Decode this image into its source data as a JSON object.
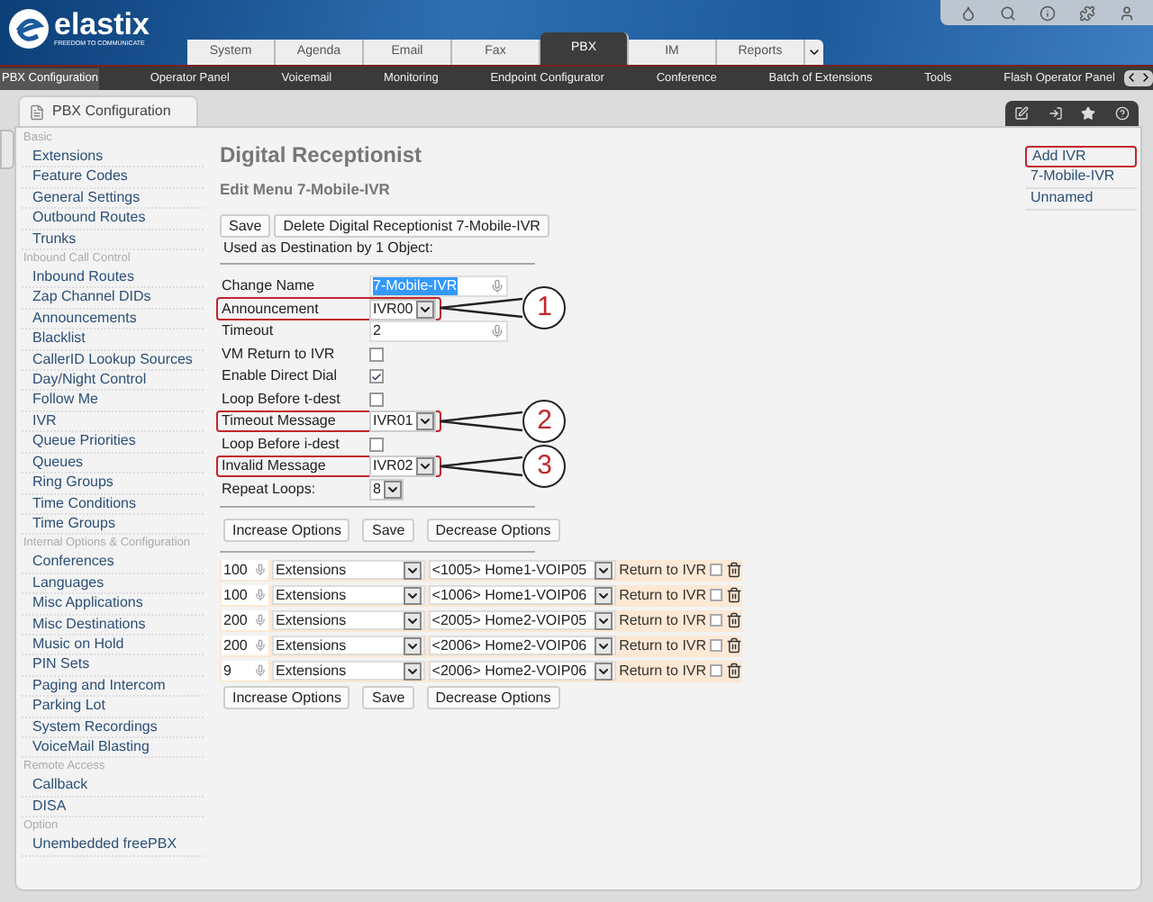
{
  "header": {
    "logo": "elastix",
    "tagline": "FREEDOM TO COMMUNICATE",
    "tabs": [
      {
        "label": "System",
        "selected": false
      },
      {
        "label": "Agenda",
        "selected": false
      },
      {
        "label": "Email",
        "selected": false
      },
      {
        "label": "Fax",
        "selected": false
      },
      {
        "label": "PBX",
        "selected": true
      },
      {
        "label": "IM",
        "selected": false
      },
      {
        "label": "Reports",
        "selected": false
      }
    ]
  },
  "menu": [
    {
      "label": "PBX Configuration",
      "selected": true
    },
    {
      "label": "Operator Panel",
      "selected": false
    },
    {
      "label": "Voicemail",
      "selected": false
    },
    {
      "label": "Monitoring",
      "selected": false
    },
    {
      "label": "Endpoint Configurator",
      "selected": false
    },
    {
      "label": "Conference",
      "selected": false
    },
    {
      "label": "Batch of Extensions",
      "selected": false
    },
    {
      "label": "Tools",
      "selected": false
    },
    {
      "label": "Flash Operator Panel",
      "selected": false
    }
  ],
  "page_tab": "PBX Configuration",
  "sidebar": [
    {
      "kind": "heading",
      "label": "Basic"
    },
    {
      "kind": "link",
      "label": "Extensions"
    },
    {
      "kind": "link",
      "label": "Feature Codes"
    },
    {
      "kind": "link",
      "label": "General Settings"
    },
    {
      "kind": "link",
      "label": "Outbound Routes"
    },
    {
      "kind": "link",
      "label": "Trunks"
    },
    {
      "kind": "heading",
      "label": "Inbound Call Control"
    },
    {
      "kind": "link",
      "label": "Inbound Routes"
    },
    {
      "kind": "link",
      "label": "Zap Channel DIDs"
    },
    {
      "kind": "link",
      "label": "Announcements"
    },
    {
      "kind": "link",
      "label": "Blacklist"
    },
    {
      "kind": "link",
      "label": "CallerID Lookup Sources"
    },
    {
      "kind": "link",
      "label": "Day/Night Control"
    },
    {
      "kind": "link",
      "label": "Follow Me"
    },
    {
      "kind": "link",
      "label": "IVR"
    },
    {
      "kind": "link",
      "label": "Queue Priorities"
    },
    {
      "kind": "link",
      "label": "Queues"
    },
    {
      "kind": "link",
      "label": "Ring Groups"
    },
    {
      "kind": "link",
      "label": "Time Conditions"
    },
    {
      "kind": "link",
      "label": "Time Groups"
    },
    {
      "kind": "heading",
      "label": "Internal Options & Configuration"
    },
    {
      "kind": "link",
      "label": "Conferences"
    },
    {
      "kind": "link",
      "label": "Languages"
    },
    {
      "kind": "link",
      "label": "Misc Applications"
    },
    {
      "kind": "link",
      "label": "Misc Destinations"
    },
    {
      "kind": "link",
      "label": "Music on Hold"
    },
    {
      "kind": "link",
      "label": "PIN Sets"
    },
    {
      "kind": "link",
      "label": "Paging and Intercom"
    },
    {
      "kind": "link",
      "label": "Parking Lot"
    },
    {
      "kind": "link",
      "label": "System Recordings"
    },
    {
      "kind": "link",
      "label": "VoiceMail Blasting"
    },
    {
      "kind": "heading",
      "label": "Remote Access"
    },
    {
      "kind": "link",
      "label": "Callback"
    },
    {
      "kind": "link",
      "label": "DISA"
    },
    {
      "kind": "heading",
      "label": "Option"
    },
    {
      "kind": "link",
      "label": "Unembedded freePBX"
    }
  ],
  "content": {
    "title": "Digital Receptionist",
    "subtitle": "Edit Menu 7-Mobile-IVR",
    "top_buttons": [
      "Save",
      "Delete Digital Receptionist 7-Mobile-IVR"
    ],
    "usage": "Used as Destination by 1 Object:",
    "fields": [
      {
        "kind": "text",
        "label": "Change Name",
        "value": "7-Mobile-IVR",
        "highlighted": false,
        "value_selected": true
      },
      {
        "kind": "select",
        "label": "Announcement",
        "value": "IVR00",
        "highlighted": true,
        "callout": "1"
      },
      {
        "kind": "text",
        "label": "Timeout",
        "value": "2",
        "highlighted": false,
        "value_selected": false
      },
      {
        "kind": "checkbox",
        "label": "VM Return to IVR",
        "checked": false,
        "highlighted": false
      },
      {
        "kind": "checkbox",
        "label": "Enable Direct Dial",
        "checked": true,
        "highlighted": false
      },
      {
        "kind": "checkbox",
        "label": "Loop Before t-dest",
        "checked": false,
        "highlighted": false
      },
      {
        "kind": "select",
        "label": "Timeout Message",
        "value": "IVR01",
        "highlighted": true,
        "callout": "2"
      },
      {
        "kind": "checkbox",
        "label": "Loop Before i-dest",
        "checked": false,
        "highlighted": false
      },
      {
        "kind": "select",
        "label": "Invalid Message",
        "value": "IVR02",
        "highlighted": true,
        "callout": "3"
      },
      {
        "kind": "select",
        "label": "Repeat Loops:",
        "value": "8",
        "highlighted": false
      }
    ],
    "option_buttons_top": [
      "Increase Options",
      "Save",
      "Decrease Options"
    ],
    "options": [
      {
        "digits": "100",
        "type": "Extensions",
        "destination": "<1005> Home1-VOIP05",
        "return_label": "Return to IVR",
        "return": false
      },
      {
        "digits": "100",
        "type": "Extensions",
        "destination": "<1006> Home1-VOIP06",
        "return_label": "Return to IVR",
        "return": false
      },
      {
        "digits": "200",
        "type": "Extensions",
        "destination": "<2005> Home2-VOIP05",
        "return_label": "Return to IVR",
        "return": false
      },
      {
        "digits": "200",
        "type": "Extensions",
        "destination": "<2006> Home2-VOIP06",
        "return_label": "Return to IVR",
        "return": false
      },
      {
        "digits": "9",
        "type": "Extensions",
        "destination": "<2006> Home2-VOIP06",
        "return_label": "Return to IVR",
        "return": false
      }
    ],
    "option_buttons_bottom": [
      "Increase Options",
      "Save",
      "Decrease Options"
    ]
  },
  "ivr_list": [
    {
      "label": "Add IVR",
      "highlighted": true
    },
    {
      "label": "7-Mobile-IVR",
      "highlighted": false
    },
    {
      "label": "Unnamed",
      "highlighted": false
    }
  ]
}
